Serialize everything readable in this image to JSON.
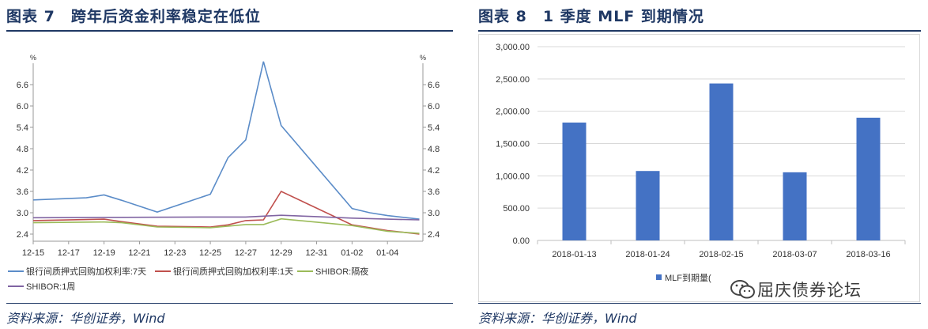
{
  "left": {
    "title": "图表 7　跨年后资金利率稳定在低位",
    "source": "资料来源：华创证券，Wind"
  },
  "right": {
    "title": "图表 8　1 季度 MLF 到期情况",
    "source": "资料来源：华创证券，Wind"
  },
  "watermark": {
    "text": "屈庆债券论坛"
  },
  "chart_data": [
    {
      "type": "line",
      "ylabel_left": "%",
      "ylabel_right": "%",
      "ylim": [
        2.2,
        7.2
      ],
      "yticks": [
        "2.4",
        "3.0",
        "3.6",
        "4.2",
        "4.8",
        "5.4",
        "6.0",
        "6.6"
      ],
      "xlim": [
        0,
        22
      ],
      "xticks": [
        {
          "label": "12-15",
          "x": 0
        },
        {
          "label": "12-17",
          "x": 2
        },
        {
          "label": "12-19",
          "x": 4
        },
        {
          "label": "12-21",
          "x": 6
        },
        {
          "label": "12-23",
          "x": 8
        },
        {
          "label": "12-25",
          "x": 10
        },
        {
          "label": "12-27",
          "x": 12
        },
        {
          "label": "12-29",
          "x": 14
        },
        {
          "label": "12-31",
          "x": 16
        },
        {
          "label": "01-02",
          "x": 18
        },
        {
          "label": "01-04",
          "x": 20
        }
      ],
      "series": [
        {
          "name": "银行间质押式回购加权利率:7天",
          "color": "#5b8cc8",
          "points": [
            [
              0,
              3.36
            ],
            [
              3,
              3.42
            ],
            [
              4,
              3.5
            ],
            [
              5,
              3.35
            ],
            [
              7,
              3.02
            ],
            [
              10,
              3.52
            ],
            [
              11,
              4.55
            ],
            [
              12,
              5.05
            ],
            [
              13,
              7.25
            ],
            [
              14,
              5.45
            ],
            [
              18,
              3.12
            ],
            [
              19,
              3.0
            ],
            [
              20,
              2.92
            ],
            [
              21.8,
              2.82
            ]
          ]
        },
        {
          "name": "银行间质押式回购加权利率:1天",
          "color": "#c0504d",
          "points": [
            [
              0,
              2.78
            ],
            [
              4,
              2.82
            ],
            [
              5,
              2.75
            ],
            [
              7,
              2.62
            ],
            [
              10,
              2.6
            ],
            [
              11,
              2.66
            ],
            [
              12,
              2.78
            ],
            [
              13,
              2.8
            ],
            [
              14,
              3.6
            ],
            [
              18,
              2.66
            ],
            [
              20,
              2.5
            ],
            [
              21.8,
              2.4
            ]
          ]
        },
        {
          "name": "SHIBOR:隔夜",
          "color": "#9bbb59",
          "points": [
            [
              0,
              2.72
            ],
            [
              4,
              2.74
            ],
            [
              5,
              2.72
            ],
            [
              7,
              2.6
            ],
            [
              10,
              2.58
            ],
            [
              12,
              2.67
            ],
            [
              13,
              2.67
            ],
            [
              14,
              2.83
            ],
            [
              18,
              2.64
            ],
            [
              20,
              2.48
            ],
            [
              21.8,
              2.42
            ]
          ]
        },
        {
          "name": "SHIBOR:1周",
          "color": "#8064a2",
          "points": [
            [
              0,
              2.86
            ],
            [
              10,
              2.88
            ],
            [
              12,
              2.88
            ],
            [
              14,
              2.93
            ],
            [
              16,
              2.89
            ],
            [
              18,
              2.85
            ],
            [
              20,
              2.82
            ],
            [
              21.8,
              2.8
            ]
          ]
        }
      ]
    },
    {
      "type": "bar",
      "categories": [
        "2018-01-13",
        "2018-01-24",
        "2018-02-15",
        "2018-03-07",
        "2018-03-16"
      ],
      "series": [
        {
          "name": "MLF到期量(",
          "color": "#4472c4",
          "values": [
            1825,
            1075,
            2430,
            1055,
            1900
          ]
        }
      ],
      "ylim": [
        0,
        3000
      ],
      "yticks": [
        "0.00",
        "500.00",
        "1,000.00",
        "1,500.00",
        "2,000.00",
        "2,500.00",
        "3,000.00"
      ]
    }
  ]
}
